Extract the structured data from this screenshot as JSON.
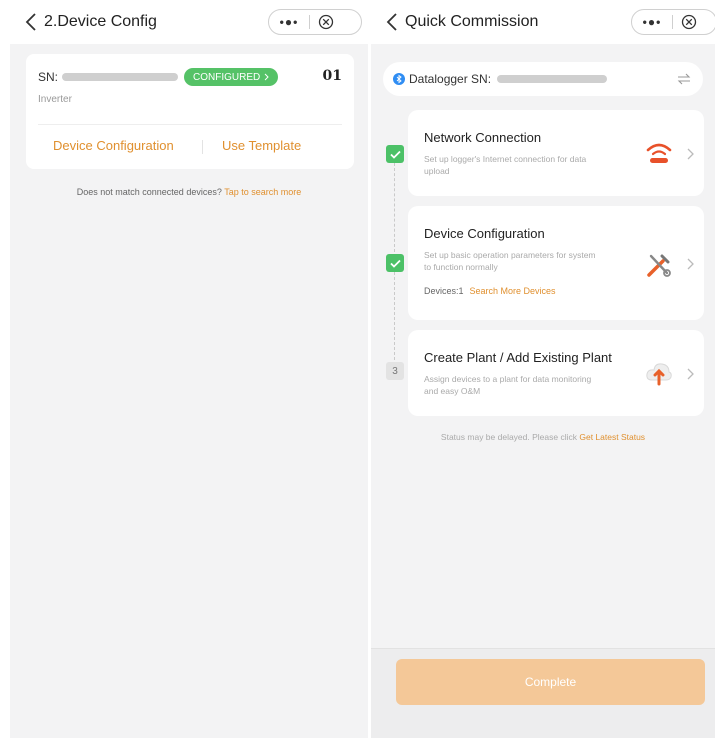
{
  "left": {
    "header": {
      "title": "2.Device Config"
    },
    "device_card": {
      "sn_label": "SN:",
      "status_badge": "CONFIGURED",
      "index": "01",
      "device_type": "Inverter",
      "actions": [
        "Device Configuration",
        "Use Template"
      ]
    },
    "hint": {
      "text": "Does not match connected devices?",
      "link": "Tap to search more"
    }
  },
  "right": {
    "header": {
      "title": "Quick Commission"
    },
    "datalogger": {
      "label": "Datalogger SN:"
    },
    "steps": [
      {
        "marker": "check",
        "title": "Network Connection",
        "desc": "Set up logger's Internet connection for data upload",
        "icon": "wifi-router-icon"
      },
      {
        "marker": "check",
        "title": "Device Configuration",
        "desc": "Set up basic operation parameters for system to function normally",
        "meta": "Devices:1",
        "meta_link": "Search More Devices",
        "icon": "tools-icon"
      },
      {
        "marker": "3",
        "title": "Create Plant / Add Existing Plant",
        "desc": "Assign devices to a plant for data monitoring and easy O&M",
        "icon": "cloud-upload-icon"
      }
    ],
    "status_hint": {
      "text": "Status may be delayed. Please click",
      "link": "Get Latest Status"
    },
    "complete_button": "Complete"
  },
  "colors": {
    "accent": "#e0902f",
    "success": "#4cc167",
    "complete_button": "#f4c898"
  }
}
